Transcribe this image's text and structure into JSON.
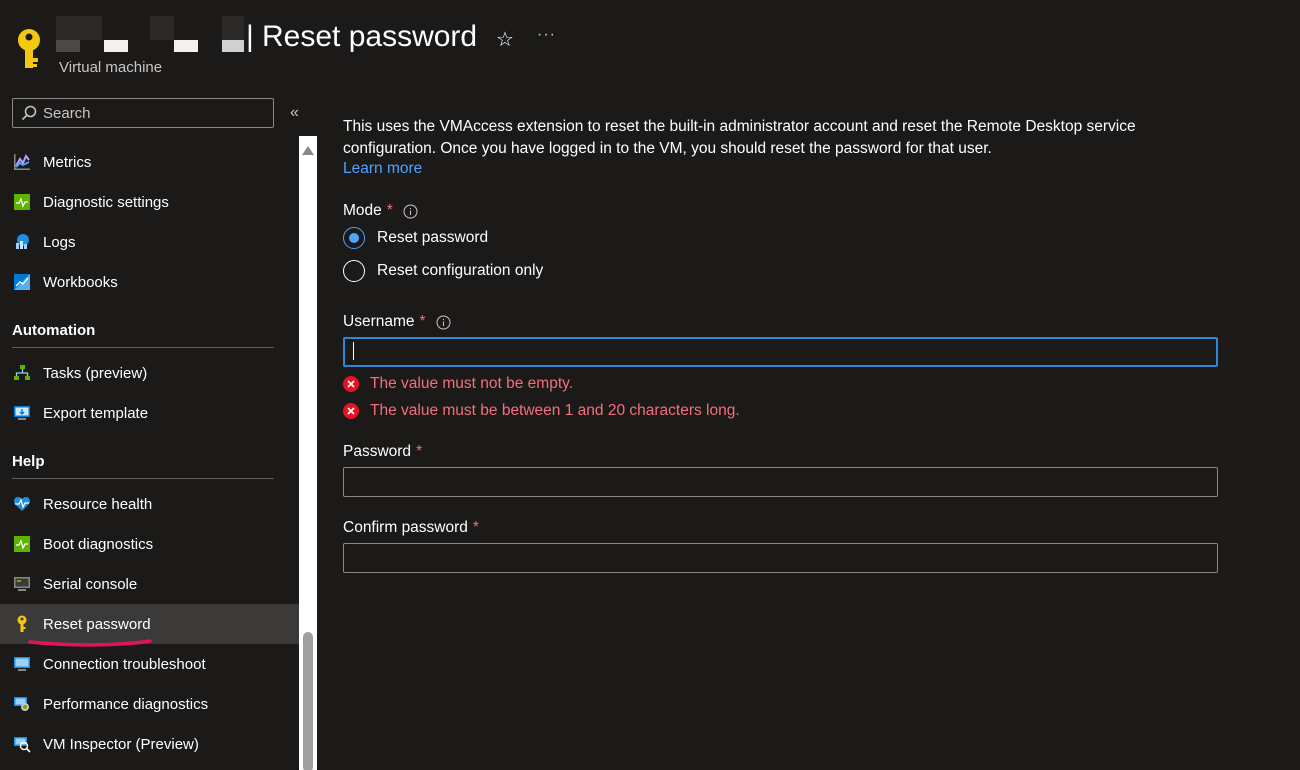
{
  "header": {
    "separator": "|",
    "title": "Reset password",
    "subtitle": "Virtual machine",
    "star_icon": "star-icon",
    "more_icon": "ellipsis-icon",
    "more_glyph": "···"
  },
  "sidebar": {
    "search_placeholder": "Search",
    "collapse_glyph": "«",
    "items": [
      {
        "label": "Metrics",
        "icon": "metrics-icon"
      },
      {
        "label": "Diagnostic settings",
        "icon": "diagnostic-settings-icon"
      },
      {
        "label": "Logs",
        "icon": "logs-icon"
      },
      {
        "label": "Workbooks",
        "icon": "workbooks-icon"
      }
    ],
    "sections": [
      {
        "title": "Automation",
        "items": [
          {
            "label": "Tasks (preview)",
            "icon": "tasks-icon"
          },
          {
            "label": "Export template",
            "icon": "export-template-icon"
          }
        ]
      },
      {
        "title": "Help",
        "items": [
          {
            "label": "Resource health",
            "icon": "resource-health-icon"
          },
          {
            "label": "Boot diagnostics",
            "icon": "boot-diagnostics-icon"
          },
          {
            "label": "Serial console",
            "icon": "serial-console-icon"
          },
          {
            "label": "Reset password",
            "icon": "key-icon",
            "active": true
          },
          {
            "label": "Connection troubleshoot",
            "icon": "connection-troubleshoot-icon"
          },
          {
            "label": "Performance diagnostics",
            "icon": "performance-diagnostics-icon"
          },
          {
            "label": "VM Inspector (Preview)",
            "icon": "vm-inspector-icon"
          }
        ]
      }
    ]
  },
  "main": {
    "description": "This uses the VMAccess extension to reset the built-in administrator account and reset the Remote Desktop service configuration. Once you have logged in to the VM, you should reset the password for that user.",
    "learn_more": "Learn more",
    "mode": {
      "label": "Mode",
      "required_mark": "*",
      "options": [
        {
          "label": "Reset password",
          "checked": true
        },
        {
          "label": "Reset configuration only",
          "checked": false
        }
      ]
    },
    "username": {
      "label": "Username",
      "required_mark": "*",
      "value": "",
      "errors": [
        "The value must not be empty.",
        "The value must be between 1 and 20 characters long."
      ]
    },
    "password": {
      "label": "Password",
      "required_mark": "*",
      "value": ""
    },
    "confirm_password": {
      "label": "Confirm password",
      "required_mark": "*",
      "value": ""
    }
  },
  "colors": {
    "background": "#1b1a19",
    "accent": "#4ea3ff",
    "error": "#f1707b",
    "active_item": "#3b3a39",
    "annotation": "#e3135b"
  }
}
